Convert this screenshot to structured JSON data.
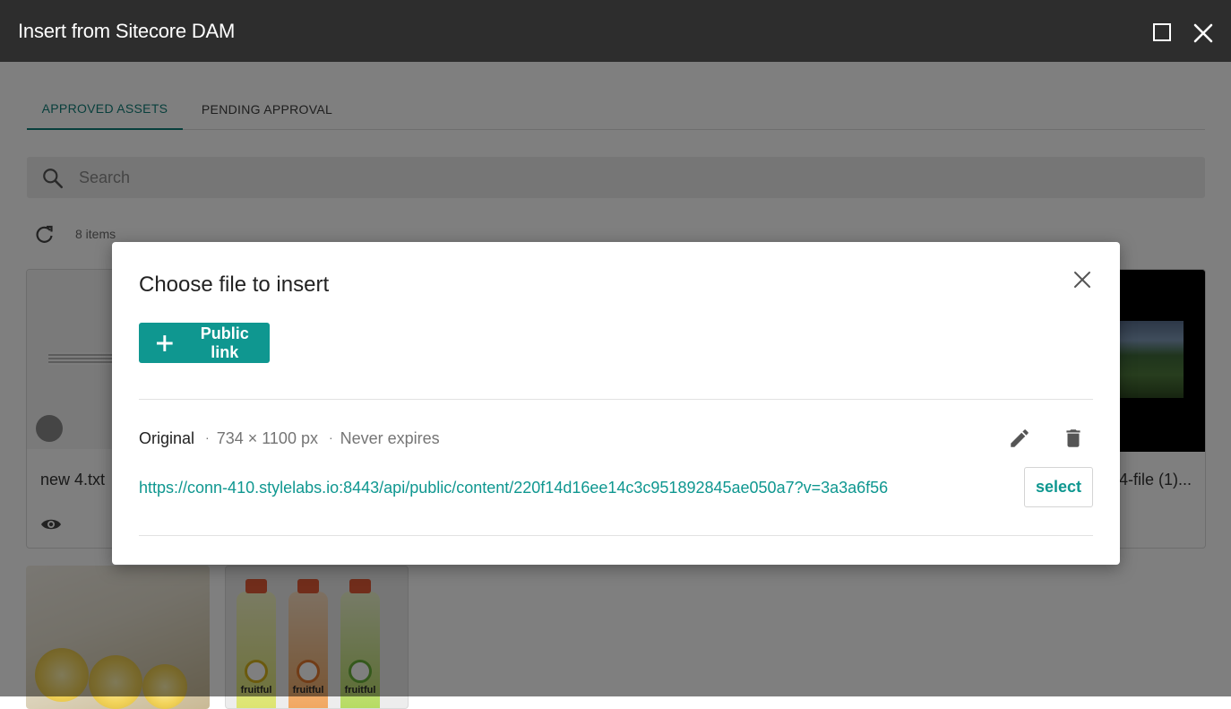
{
  "window": {
    "title": "Insert from Sitecore DAM"
  },
  "tabs": [
    {
      "label": "APPROVED ASSETS",
      "active": true
    },
    {
      "label": "PENDING APPROVAL",
      "active": false
    }
  ],
  "search": {
    "placeholder": "Search"
  },
  "toolbar": {
    "count": "8 items"
  },
  "cards": [
    {
      "name": "new 4.txt"
    },
    {
      "name": "4-file (1)..."
    },
    {
      "name": ""
    },
    {
      "name": ""
    }
  ],
  "card4": {
    "brand": "fruitful"
  },
  "dialog": {
    "title": "Choose file to insert",
    "public_link_label": "Public link",
    "rendition": {
      "name": "Original",
      "dimensions": "734 × 1100 px",
      "expiry": "Never expires",
      "url": "https://conn-410.stylelabs.io:8443/api/public/content/220f14d16ee14c3c951892845ae050a7?v=3a3a6f56",
      "select_label": "select"
    }
  },
  "colors": {
    "accent": "#0f9790",
    "titlebar": "#2d2d2d"
  }
}
